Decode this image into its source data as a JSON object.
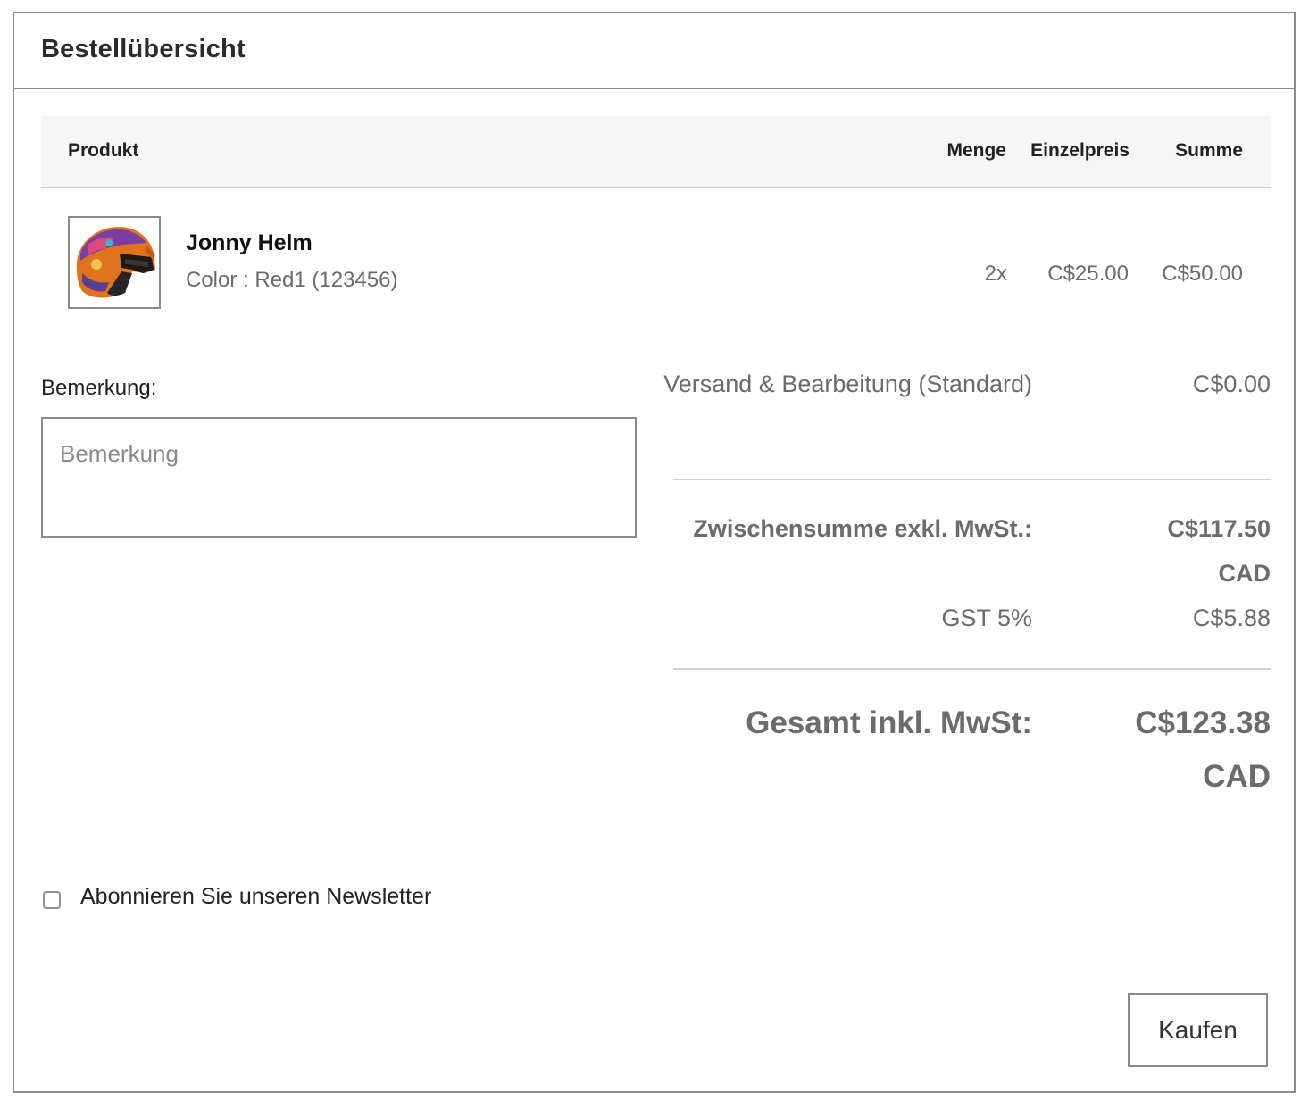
{
  "header": {
    "title": "Bestellübersicht"
  },
  "table": {
    "columns": [
      "Produkt",
      "Menge",
      "Einzelpreis",
      "Summe"
    ],
    "items": [
      {
        "name": "Jonny Helm",
        "variant": "Color : Red1 (123456)",
        "quantity": "2x",
        "unit_price": "C$25.00",
        "total": "C$50.00",
        "image_icon": "helmet-image"
      }
    ]
  },
  "remark": {
    "label": "Bemerkung:",
    "placeholder": "Bemerkung",
    "value": ""
  },
  "totals": {
    "shipping_label": "Versand & Bearbeitung (Standard)",
    "shipping_value": "C$0.00",
    "subtotal_label": "Zwischensumme exkl. MwSt.:",
    "subtotal_value": "C$117.50 CAD",
    "tax_label": "GST 5%",
    "tax_value": "C$5.88",
    "grand_total_label": "Gesamt inkl. MwSt:",
    "grand_total_value": "C$123.38 CAD"
  },
  "newsletter": {
    "label": "Abonnieren Sie unseren Newsletter",
    "checked": false
  },
  "actions": {
    "buy_label": "Kaufen"
  },
  "colors": {
    "border": "#8a8a8a",
    "header_bg": "#f6f6f6",
    "muted_text": "#6b6b6b",
    "text": "#222222"
  }
}
